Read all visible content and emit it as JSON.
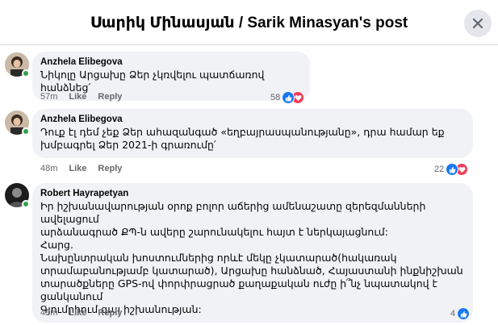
{
  "header": {
    "title": "Սարիկ Մինասյան / Sarik Minasyan's post"
  },
  "comments": [
    {
      "author": "Anzhela Elibegova",
      "text": "Նիկոլը Արցախը Ձեր չկռվելու պատճառով հանձնեց՛",
      "time": "57m",
      "like_label": "Like",
      "reply_label": "Reply",
      "reaction_count": "58",
      "reactions": [
        "like-icon",
        "love-icon"
      ]
    },
    {
      "author": "Anzhela Elibegova",
      "text": "Դուք էլ դեմ չեք Ձեր աhազանգած «եղբայրասպանությանը», դրա համար եք\nխմբագրել Ձեր 2021-ի գրառումը՛",
      "time": "48m",
      "like_label": "Like",
      "reply_label": "Reply",
      "reaction_count": "22",
      "reactions": [
        "like-icon",
        "love-icon"
      ]
    },
    {
      "author": "Robert Hayrapetyan",
      "text": "Իր իշխանավարության օրոք բոլոր աճերից ամենաշատը զերեզմանների ավելացում\nարձանագրած ՔՊ-ն ավերը շարունակելու հայտ է ներկայացնում:\nՀարց.\nՆախընտրական խոստումներից որևէ մեկը չկատարած(հակառակ\nտրամաբանությամբ կատարած), Արցախը հանձնած, Հայաստանի ինքնիշխան\nտարածքները GPS-ով փորփրացրած քաղաքական ուժը ի՞նչ նպատակով է ցանկանում\nԳյումրիում գալ իշխանության:",
      "time": "43m",
      "like_label": "Like",
      "reply_label": "Reply",
      "reaction_count": "4",
      "reactions": [
        "like-icon"
      ]
    }
  ],
  "colors": {
    "like": "#1877f2",
    "love": "#f33e58",
    "bubble": "#f0f2f5",
    "online": "#31a24c",
    "meta": "#65676b"
  }
}
